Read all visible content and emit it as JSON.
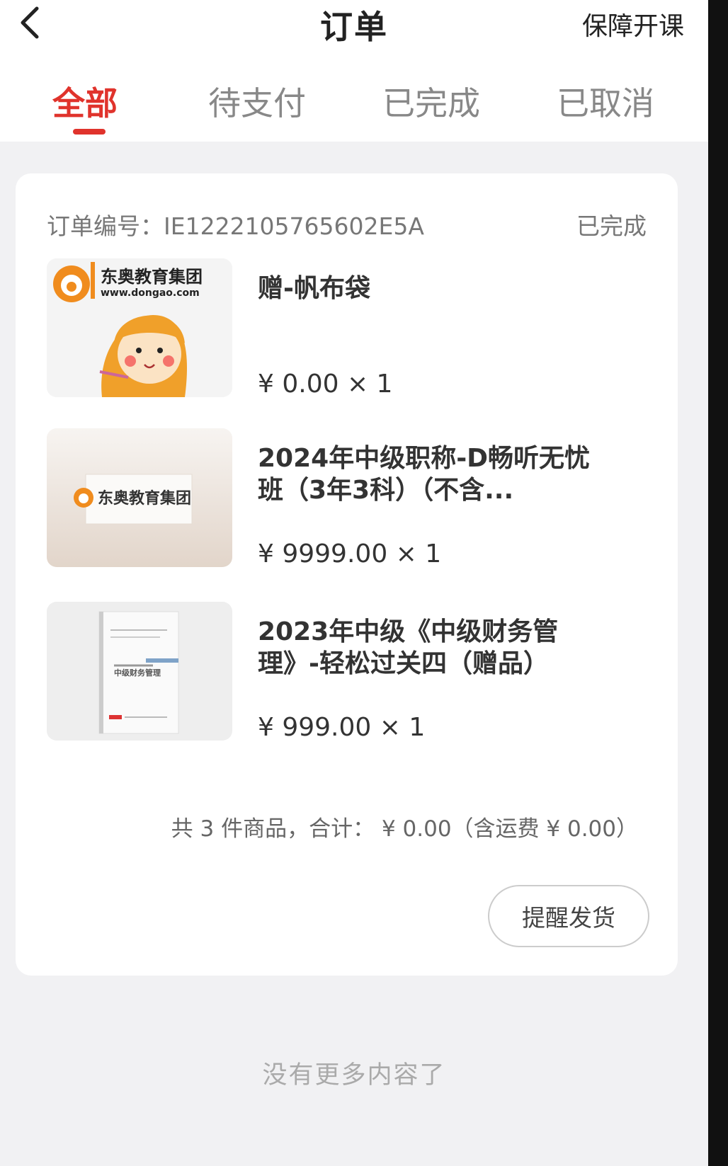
{
  "header": {
    "title": "订单",
    "right_link": "保障开课"
  },
  "tabs": [
    {
      "label": "全部",
      "active": true
    },
    {
      "label": "待支付",
      "active": false
    },
    {
      "label": "已完成",
      "active": false
    },
    {
      "label": "已取消",
      "active": false
    }
  ],
  "order": {
    "number_label": "订单编号：",
    "number": "IE1222105765602E5A",
    "status": "已完成",
    "items": [
      {
        "name": "赠-帆布袋",
        "price": "¥ 0.00 × 1",
        "thumb_brand": "东奥教育集团",
        "thumb_url": "www.dongao.com"
      },
      {
        "name": "2024年中级职称-D畅听无忧班（3年3科）（不含...",
        "price": "¥ 9999.00 × 1",
        "thumb_brand": "东奥教育集团"
      },
      {
        "name": "2023年中级《中级财务管理》-轻松过关四（赠品）",
        "price": "¥ 999.00 × 1",
        "thumb_book_title": "中级财务管理"
      }
    ],
    "summary": "共 3 件商品，合计： ¥ 0.00（含运费 ¥ 0.00）",
    "action_label": "提醒发货"
  },
  "footer": {
    "no_more": "没有更多内容了"
  },
  "colors": {
    "accent": "#e0332c",
    "background": "#f1f1f3",
    "brand_orange": "#f08c1e"
  }
}
